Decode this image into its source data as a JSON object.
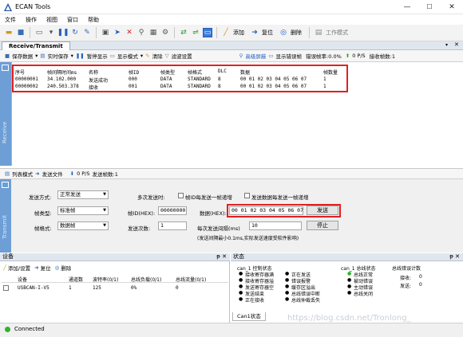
{
  "window": {
    "title": "ECAN Tools",
    "controls": [
      "—",
      "☐",
      "✕"
    ]
  },
  "menu": [
    "文件",
    "操作",
    "视图",
    "窗口",
    "帮助"
  ],
  "toolbar": {
    "add_label": "添加",
    "reset_label": "复位",
    "delete_label": "删除",
    "work_mode_label": "工作模式"
  },
  "receive": {
    "tab_label": "Receive/Transmit",
    "side_label": "Receive",
    "tools": {
      "save_data": "保存数据",
      "realtime_save": "实时保存",
      "pause_display": "暂停显示",
      "display_mode": "显示模式",
      "clear": "清除",
      "filter_settings": "滤波设置",
      "advanced_filter": "高级屏蔽",
      "show_error_frames": "显示错误帧",
      "error_rate": "错误帧率:0.0%",
      "rate": "0 P/S",
      "recv_count": "接收帧数:1"
    },
    "columns": [
      "序号",
      "帧间隔时间ms",
      "名称",
      "帧ID",
      "帧类型",
      "帧格式",
      "DLC",
      "数据",
      "帧数量"
    ],
    "rows": [
      {
        "seq": "00000001",
        "time": "34.102.000",
        "name": "发送成功",
        "id": "000",
        "type": "DATA",
        "format": "STANDARD",
        "dlc": "8",
        "data": "00 01 02 03 04 05 06 07",
        "count": "1"
      },
      {
        "seq": "00000002",
        "time": "240.503.378",
        "name": "接收",
        "id": "001",
        "type": "DATA",
        "format": "STANDARD",
        "dlc": "8",
        "data": "00 01 02 03 04 05 06 07",
        "count": "1"
      }
    ]
  },
  "transmit": {
    "side_label": "Transmit",
    "tools": {
      "list_mode": "列表模式",
      "send_file": "发送文件",
      "rate": "0 P/S",
      "send_count": "发送帧数:1"
    },
    "send_mode_label": "发送方式:",
    "send_mode_value": "正常发送",
    "multi_send_label": "多次发送时:",
    "id_increment_label": "帧ID每发送一帧递增",
    "data_increment_label": "发送数据每发送一帧递增",
    "frame_type_label": "帧类型:",
    "frame_type_value": "标准帧",
    "frame_id_label": "帧ID(HEX):",
    "frame_id_value": "00000000",
    "data_label": "数据(HEX):",
    "data_value": "00 01 02 03 04 05 06 07",
    "send_button": "发送",
    "frame_format_label": "帧格式:",
    "frame_format_value": "数据帧",
    "send_times_label": "发送次数:",
    "send_times_value": "1",
    "interval_label": "每次发送间隔(ms)",
    "interval_value": "10",
    "stop_button": "停止",
    "note": "(发送间隔最小0.1ms,实际发送速度受软件影响)"
  },
  "devices": {
    "title": "设备",
    "pin": "ᵽ ✕",
    "tools": {
      "add_settings": "添加/设置",
      "reset": "复位",
      "delete": "删除"
    },
    "columns": [
      "设备",
      "通道数",
      "波特率(0/1)",
      "总线负载(0/1)",
      "总线流量(0/1)"
    ],
    "rows": [
      {
        "name": "USBCAN-I-V5",
        "channels": "1",
        "baud": "125",
        "load": "0%",
        "flow": "0"
      }
    ]
  },
  "status_panel": {
    "title": "状态",
    "pin": "ᵽ ✕",
    "ctrl_title": "can_1 控制状态",
    "ctrl_col1": [
      "接收寄存器满",
      "接收寄存器溢",
      "发送寄存器空",
      "发送结束",
      "正在接收"
    ],
    "ctrl_col2": [
      "正在发送",
      "错误报警",
      "缓存区溢出",
      "总线错误中断",
      "总线仲裁丢失"
    ],
    "bus_title": "can_1 总线状态",
    "bus_items": [
      "总线正常",
      "被动错误",
      "主动错误",
      "总线关闭"
    ],
    "err_title": "总线错误计数",
    "recv_err_label": "接收:",
    "recv_err_value": "0",
    "send_err_label": "发送:",
    "send_err_value": "0",
    "tab_label": "Can1状态"
  },
  "statusbar": {
    "text": "Connected"
  },
  "watermark": "https://blog.csdn.net/Tronlong_",
  "colors": {
    "accent_blue": "#6d9ed6",
    "highlight_red": "#e02020",
    "connected_green": "#2bb52b"
  }
}
